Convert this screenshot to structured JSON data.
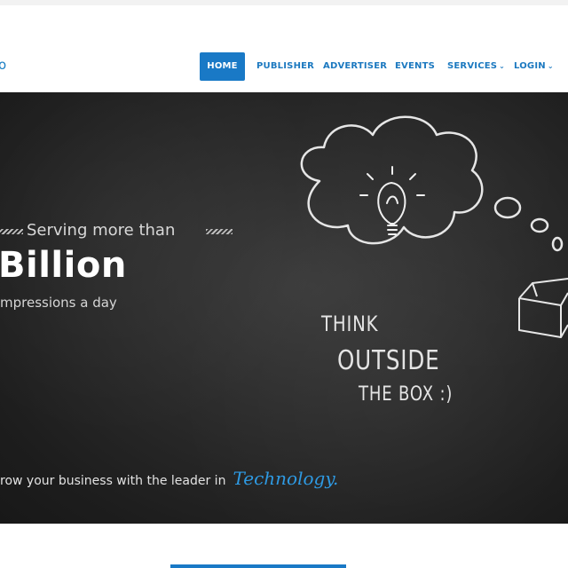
{
  "header": {
    "logo_fragment": "o"
  },
  "nav": {
    "items": [
      {
        "label": "HOME",
        "active": true
      },
      {
        "label": "PUBLISHER"
      },
      {
        "label": "ADVERTISER"
      },
      {
        "label": "EVENTS"
      },
      {
        "label": "SERVICES",
        "dropdown": true
      },
      {
        "label": "LOGIN",
        "dropdown": true
      }
    ],
    "caret": "⌄"
  },
  "hero": {
    "serving": "Serving more than",
    "headline": "Billion",
    "subline": "mpressions a day",
    "think": "THINK",
    "outside": "OUTSIDE",
    "the_box": "THE BOX :)",
    "grow_text": "row your business with the leader in",
    "technology": "Technology."
  },
  "colors": {
    "accent": "#1979c6",
    "nav_text": "#1c79c0",
    "hero_bg": "#262626",
    "tech_blue": "#2e9ae3"
  },
  "icons": [
    "lightbulb-icon",
    "thought-cloud-icon",
    "box-icon"
  ]
}
